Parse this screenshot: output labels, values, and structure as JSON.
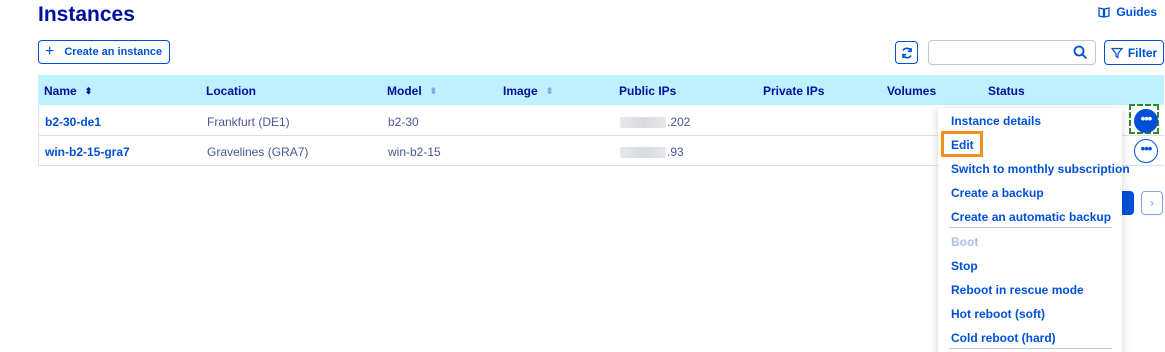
{
  "header": {
    "title": "Instances",
    "guides_label": "Guides"
  },
  "toolbar": {
    "create_label": "Create an instance",
    "search_value": "",
    "search_placeholder": "",
    "filter_label": "Filter"
  },
  "table": {
    "columns": [
      "Name",
      "Location",
      "Model",
      "Image",
      "Public IPs",
      "Private IPs",
      "Volumes",
      "Status"
    ],
    "rows": [
      {
        "name": "b2-30-de1",
        "location": "Frankfurt (DE1)",
        "model": "b2-30",
        "image": "",
        "public_ip": ".202",
        "private_ip": "",
        "volumes": "",
        "status": ""
      },
      {
        "name": "win-b2-15-gra7",
        "location": "Gravelines (GRA7)",
        "model": "win-b2-15",
        "image": "",
        "public_ip": ".93",
        "private_ip": "",
        "volumes": "",
        "status": ""
      }
    ]
  },
  "actions_menu": {
    "items": [
      "Instance details",
      "Edit",
      "Switch to monthly subscription",
      "Create a backup",
      "Create an automatic backup",
      "Boot",
      "Stop",
      "Reboot in rescue mode",
      "Hot reboot (soft)",
      "Cold reboot (hard)"
    ],
    "disabled_items": [
      "Boot"
    ],
    "highlighted_item": "Edit"
  },
  "colors": {
    "primary": "#0050d7",
    "title": "#000e9c",
    "header_bg": "#bef1ff",
    "highlight": "#f0901a"
  }
}
